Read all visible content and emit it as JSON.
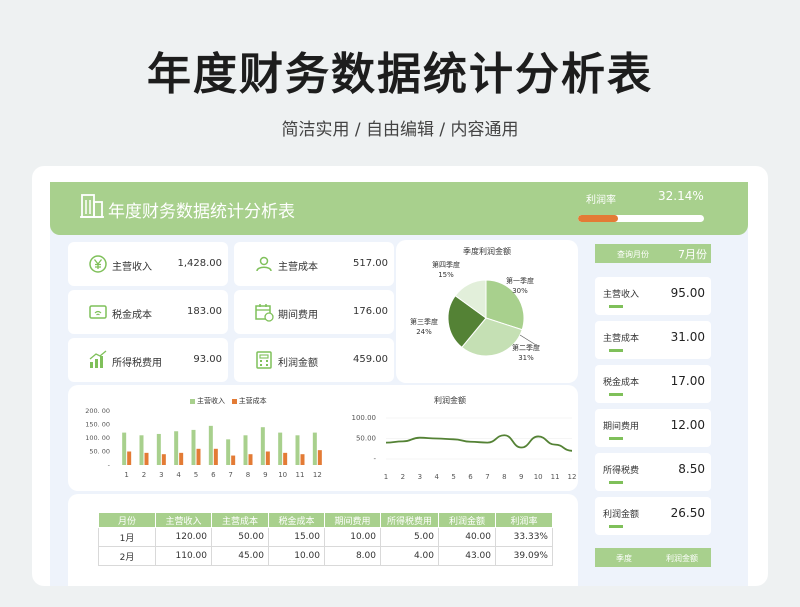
{
  "page": {
    "title": "年度财务数据统计分析表",
    "subtitle": "简洁实用 / 自由编辑 / 内容通用"
  },
  "header": {
    "title": "年度财务数据统计分析表",
    "profit_rate_label": "利润率",
    "profit_rate_value": "32.14%",
    "profit_rate_fraction": 0.3214
  },
  "kpis": [
    {
      "label": "主营收入",
      "value": "1,428.00",
      "icon": "yen-coin-icon"
    },
    {
      "label": "主营成本",
      "value": "517.00",
      "icon": "user-icon"
    },
    {
      "label": "税金成本",
      "value": "183.00",
      "icon": "wallet-icon"
    },
    {
      "label": "期间费用",
      "value": "176.00",
      "icon": "calendar-icon"
    },
    {
      "label": "所得税费用",
      "value": "93.00",
      "icon": "bar-chart-icon"
    },
    {
      "label": "利润金额",
      "value": "459.00",
      "icon": "calculator-icon"
    }
  ],
  "pie_chart": {
    "title": "季度利润金额",
    "slices": [
      {
        "name": "第一季度",
        "percent": "30%",
        "value": 30,
        "color": "#a8d08d"
      },
      {
        "name": "第二季度",
        "percent": "31%",
        "value": 31,
        "color": "#c5e0b4"
      },
      {
        "name": "第三季度",
        "percent": "24%",
        "value": 24,
        "color": "#548235"
      },
      {
        "name": "第四季度",
        "percent": "15%",
        "value": 15,
        "color": "#e2efda"
      }
    ]
  },
  "chart_data": [
    {
      "type": "bar",
      "title": "",
      "categories": [
        "1",
        "2",
        "3",
        "4",
        "5",
        "6",
        "7",
        "8",
        "9",
        "10",
        "11",
        "12"
      ],
      "series": [
        {
          "name": "主营收入",
          "color": "#a8d08d",
          "values": [
            120,
            110,
            115,
            125,
            130,
            145,
            95,
            110,
            140,
            120,
            110,
            120
          ]
        },
        {
          "name": "主营成本",
          "color": "#e37b35",
          "values": [
            50,
            45,
            40,
            45,
            60,
            60,
            35,
            40,
            50,
            45,
            40,
            55
          ]
        }
      ],
      "ylim": [
        0,
        200
      ],
      "yticks": [
        "200. 00",
        "150. 00",
        "100. 00",
        "50. 00",
        "-"
      ],
      "legend": "top"
    },
    {
      "type": "line",
      "title": "利润金额",
      "categories": [
        "1",
        "2",
        "3",
        "4",
        "5",
        "6",
        "7",
        "8",
        "9",
        "10",
        "11",
        "12"
      ],
      "series": [
        {
          "name": "",
          "color": "#548235",
          "values": [
            40,
            43,
            52,
            50,
            48,
            42,
            40,
            58,
            28,
            55,
            35,
            20
          ]
        }
      ],
      "ylim": [
        0,
        100
      ],
      "yticks": [
        "100.00",
        "50.00",
        "-"
      ]
    }
  ],
  "table": {
    "headers": [
      "月份",
      "主营收入",
      "主营成本",
      "税金成本",
      "期间费用",
      "所得税费用",
      "利润金额",
      "利润率"
    ],
    "rows": [
      [
        "1月",
        "120.00",
        "50.00",
        "15.00",
        "10.00",
        "5.00",
        "40.00",
        "33.33%"
      ],
      [
        "2月",
        "110.00",
        "45.00",
        "10.00",
        "8.00",
        "4.00",
        "43.00",
        "39.09%"
      ]
    ]
  },
  "side": {
    "query_label": "查询月份",
    "query_value": "7月份",
    "items": [
      {
        "label": "主营收入",
        "value": "95.00",
        "bar_fraction": 0.12
      },
      {
        "label": "主营成本",
        "value": "31.00",
        "bar_fraction": 0.12
      },
      {
        "label": "税金成本",
        "value": "17.00",
        "bar_fraction": 0.12
      },
      {
        "label": "期间费用",
        "value": "12.00",
        "bar_fraction": 0.12
      },
      {
        "label": "所得税费",
        "value": "8.50",
        "bar_fraction": 0.12
      },
      {
        "label": "利润金额",
        "value": "26.50",
        "bar_fraction": 0.12
      }
    ],
    "footer": [
      "季度",
      "利润金额"
    ]
  }
}
